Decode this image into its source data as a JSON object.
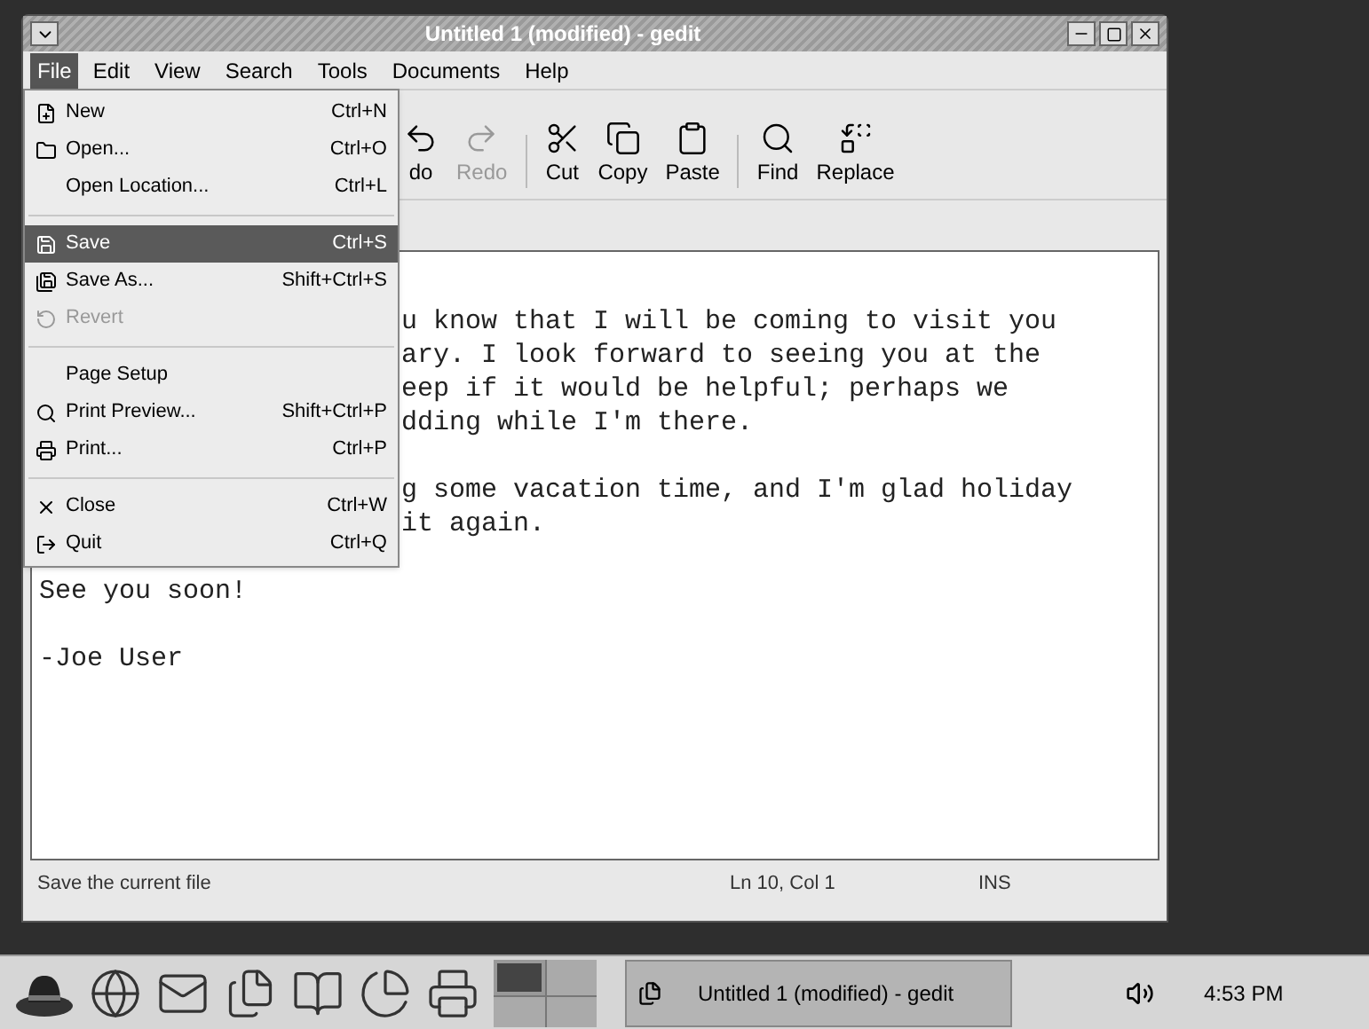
{
  "window": {
    "title": "Untitled 1 (modified) - gedit"
  },
  "menubar": [
    {
      "label": "File",
      "selected": true
    },
    {
      "label": "Edit",
      "selected": false
    },
    {
      "label": "View",
      "selected": false
    },
    {
      "label": "Search",
      "selected": false
    },
    {
      "label": "Tools",
      "selected": false
    },
    {
      "label": "Documents",
      "selected": false
    },
    {
      "label": "Help",
      "selected": false
    }
  ],
  "file_menu": [
    {
      "kind": "item",
      "label": "New",
      "shortcut": "Ctrl+N",
      "selected": false,
      "disabled": false
    },
    {
      "kind": "item",
      "label": "Open...",
      "shortcut": "Ctrl+O",
      "selected": false,
      "disabled": false
    },
    {
      "kind": "item",
      "label": "Open Location...",
      "shortcut": "Ctrl+L",
      "selected": false,
      "disabled": false
    },
    {
      "kind": "separator"
    },
    {
      "kind": "item",
      "label": "Save",
      "shortcut": "Ctrl+S",
      "selected": true,
      "disabled": false
    },
    {
      "kind": "item",
      "label": "Save As...",
      "shortcut": "Shift+Ctrl+S",
      "selected": false,
      "disabled": false
    },
    {
      "kind": "item",
      "label": "Revert",
      "selected": false,
      "disabled": true
    },
    {
      "kind": "separator"
    },
    {
      "kind": "item",
      "label": "Page Setup",
      "selected": false,
      "disabled": false
    },
    {
      "kind": "item",
      "label": "Print Preview...",
      "shortcut": "Shift+Ctrl+P",
      "selected": false,
      "disabled": false
    },
    {
      "kind": "item",
      "label": "Print...",
      "shortcut": "Ctrl+P",
      "selected": false,
      "disabled": false
    },
    {
      "kind": "separator"
    },
    {
      "kind": "item",
      "label": "Close",
      "shortcut": "Ctrl+W",
      "selected": false,
      "disabled": false
    },
    {
      "kind": "item",
      "label": "Quit",
      "shortcut": "Ctrl+Q",
      "selected": false,
      "disabled": false
    }
  ],
  "toolbar": [
    {
      "label": "do",
      "disabled": false
    },
    {
      "label": "Redo",
      "disabled": true
    },
    {
      "label": "Cut",
      "disabled": false
    },
    {
      "label": "Copy",
      "disabled": false
    },
    {
      "label": "Paste",
      "disabled": false
    },
    {
      "label": "Find",
      "disabled": false
    },
    {
      "label": "Replace",
      "disabled": false
    }
  ],
  "editor_lines": [
    {
      "kind": "clipped",
      "text": "u know that I will be coming to visit you"
    },
    {
      "kind": "clipped",
      "text": "ary. I look forward to seeing you at the"
    },
    {
      "kind": "clipped",
      "text": "eep if it would be helpful; perhaps we"
    },
    {
      "kind": "clipped",
      "text": "dding while I'm there."
    },
    {
      "kind": "blank"
    },
    {
      "kind": "clipped",
      "text": "g some vacation time, and I'm glad holiday"
    },
    {
      "kind": "clipped",
      "text": "it again."
    },
    {
      "kind": "blank"
    },
    {
      "kind": "full",
      "text": "See you soon!"
    },
    {
      "kind": "blank"
    },
    {
      "kind": "full",
      "text": "-Joe User"
    }
  ],
  "status_bar": {
    "message": "Save the current file",
    "position": "Ln 10, Col 1",
    "mode": "INS"
  },
  "taskbar": {
    "workspaces": [
      {
        "selected": true
      },
      {
        "selected": false
      },
      {
        "selected": false
      },
      {
        "selected": false
      }
    ],
    "tasks": [
      {
        "label": "Untitled 1 (modified) - gedit",
        "selected": true
      }
    ],
    "clock": "4:53 PM"
  }
}
